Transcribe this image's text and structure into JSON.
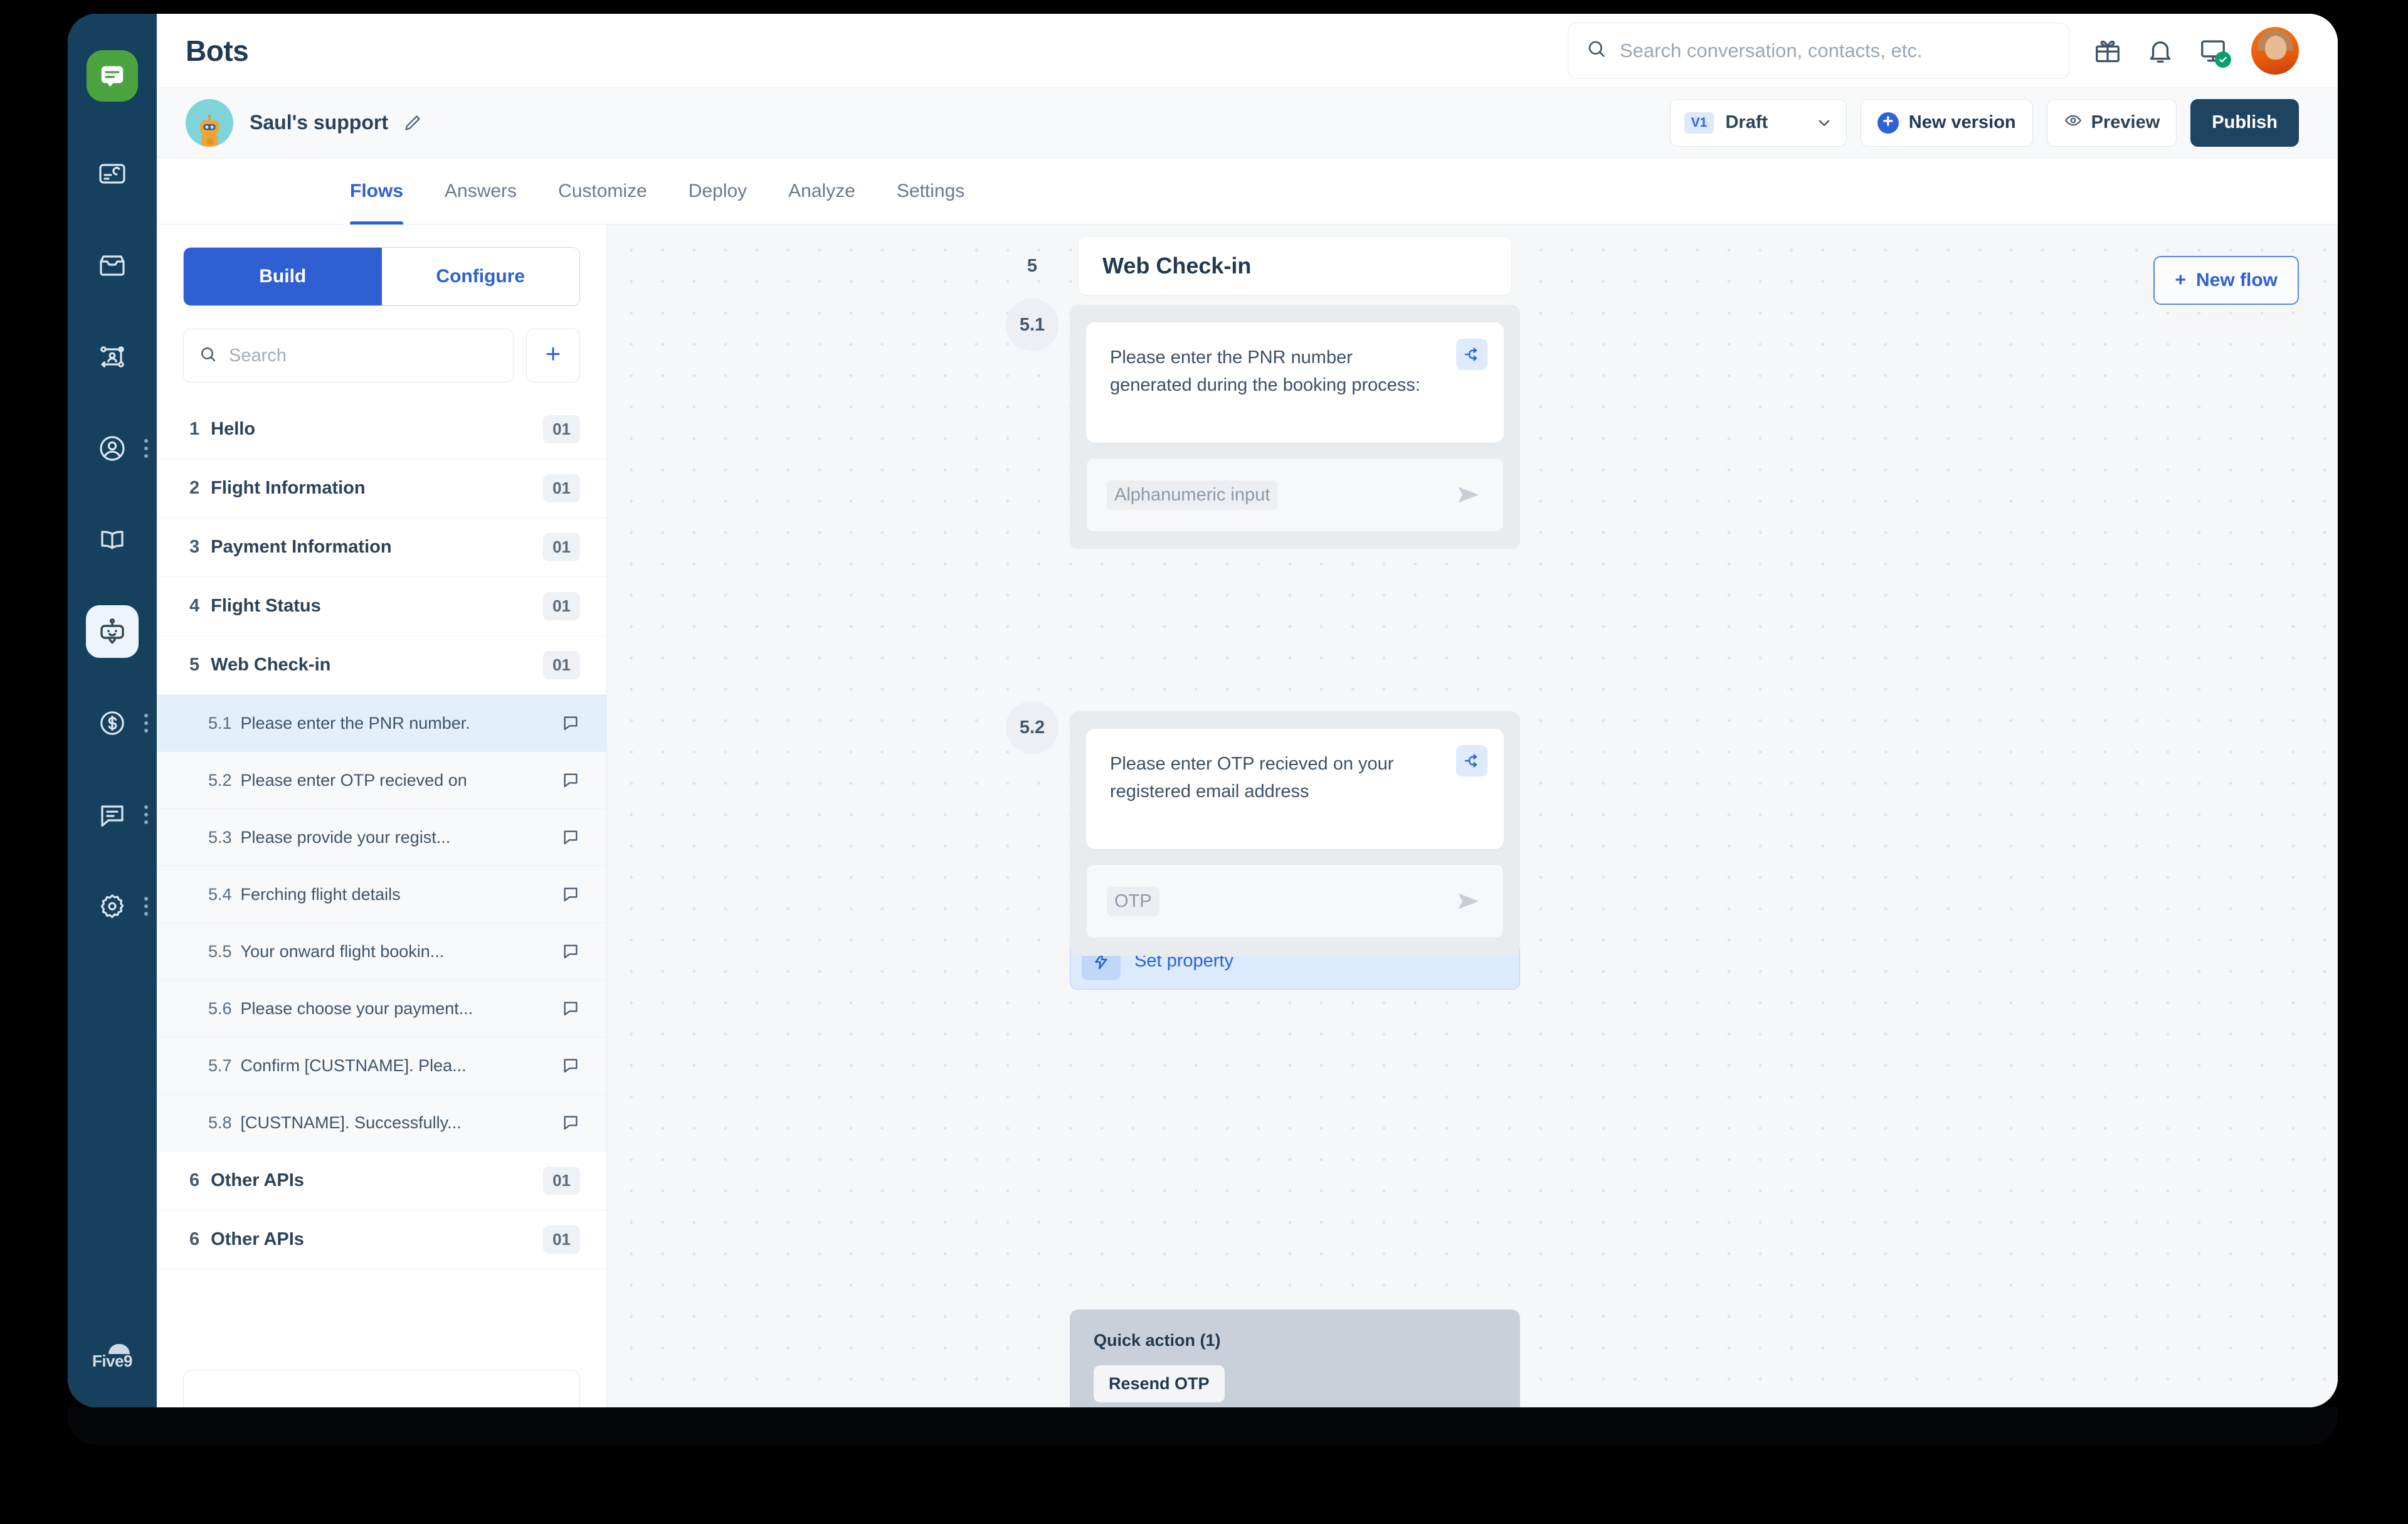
{
  "colors": {
    "rail_bg": "#15405e",
    "brand_green": "#4aa33f",
    "accent_blue": "#2d62d4",
    "publish_bg": "#1f4461",
    "canvas_bg": "#f5f7f9",
    "selected_row": "#e4effc",
    "group_box": "#e9ecef",
    "quick_action_bg": "#c9d0d9",
    "status_green": "#0aa06e",
    "avatar_orange": "#f97316"
  },
  "rail": {
    "logo_icon": "chat-logo-icon",
    "items": [
      {
        "icon": "dashboard-card-icon",
        "name": "sidebar-item-dashboard",
        "has_dots": false,
        "active": false
      },
      {
        "icon": "inbox-icon",
        "name": "sidebar-item-inbox",
        "has_dots": false,
        "active": false
      },
      {
        "icon": "journey-flow-icon",
        "name": "sidebar-item-journeys",
        "has_dots": false,
        "active": false
      },
      {
        "icon": "user-circle-icon",
        "name": "sidebar-item-contacts",
        "has_dots": true,
        "active": false
      },
      {
        "icon": "book-icon",
        "name": "sidebar-item-knowledge",
        "has_dots": false,
        "active": false
      },
      {
        "icon": "bot-icon",
        "name": "sidebar-item-bots",
        "has_dots": false,
        "active": true
      },
      {
        "icon": "dollar-circle-icon",
        "name": "sidebar-item-billing",
        "has_dots": true,
        "active": false
      },
      {
        "icon": "chat-bubble-icon",
        "name": "sidebar-item-conversations",
        "has_dots": true,
        "active": false
      },
      {
        "icon": "gear-icon",
        "name": "sidebar-item-settings",
        "has_dots": true,
        "active": false
      }
    ],
    "footer_logo": "Five9"
  },
  "header": {
    "title": "Bots",
    "search": {
      "placeholder": "Search conversation, contacts, etc.",
      "value": "",
      "icon": "search-icon"
    },
    "icons": [
      {
        "name": "gift-icon",
        "label": "gift-icon"
      },
      {
        "name": "bell-icon",
        "label": "bell-icon"
      },
      {
        "name": "screen-check-icon",
        "label": "screen-check-icon"
      }
    ],
    "avatar": "user-avatar"
  },
  "bot_bar": {
    "avatar_icon": "robot-avatar-icon",
    "bot_name": "Saul's support",
    "edit_icon": "pencil-icon",
    "version_badge": "V1",
    "version_label": "Draft",
    "new_version_label": "New version",
    "preview_label": "Preview",
    "publish_label": "Publish"
  },
  "tabs": [
    {
      "label": "Flows",
      "active": true
    },
    {
      "label": "Answers",
      "active": false
    },
    {
      "label": "Customize",
      "active": false
    },
    {
      "label": "Deploy",
      "active": false
    },
    {
      "label": "Analyze",
      "active": false
    },
    {
      "label": "Settings",
      "active": false
    }
  ],
  "flow_panel": {
    "segmented": [
      {
        "label": "Build",
        "active": true
      },
      {
        "label": "Configure",
        "active": false
      }
    ],
    "search": {
      "placeholder": "Search",
      "value": "",
      "icon": "search-icon"
    },
    "add_button": "+",
    "rows": [
      {
        "type": "flow",
        "index": "1",
        "name": "Hello",
        "count": "01",
        "selected": false
      },
      {
        "type": "flow",
        "index": "2",
        "name": "Flight Information",
        "count": "01",
        "selected": false
      },
      {
        "type": "flow",
        "index": "3",
        "name": "Payment Information",
        "count": "01",
        "selected": false
      },
      {
        "type": "flow",
        "index": "4",
        "name": "Flight Status",
        "count": "01",
        "selected": false
      },
      {
        "type": "flow",
        "index": "5",
        "name": "Web Check-in",
        "count": "01",
        "selected": false
      },
      {
        "type": "sub",
        "index": "5.1",
        "name": "Please enter the PNR number.",
        "selected": true,
        "icon": "message-bubble-icon"
      },
      {
        "type": "sub",
        "index": "5.2",
        "name": "Please enter OTP recieved on",
        "selected": false,
        "icon": "message-bubble-icon"
      },
      {
        "type": "sub",
        "index": "5.3",
        "name": "Please provide your regist...",
        "selected": false,
        "icon": "message-bubble-icon"
      },
      {
        "type": "sub",
        "index": "5.4",
        "name": "Ferching flight details",
        "selected": false,
        "icon": "message-bubble-icon"
      },
      {
        "type": "sub",
        "index": "5.5",
        "name": "Your onward flight bookin...",
        "selected": false,
        "icon": "message-bubble-icon"
      },
      {
        "type": "sub",
        "index": "5.6",
        "name": "Please choose your payment...",
        "selected": false,
        "icon": "message-bubble-icon"
      },
      {
        "type": "sub",
        "index": "5.7",
        "name": "Confirm [CUSTNAME]. Plea...",
        "selected": false,
        "icon": "message-bubble-icon"
      },
      {
        "type": "sub",
        "index": "5.8",
        "name": "[CUSTNAME]. Successfully...",
        "selected": false,
        "icon": "message-bubble-icon"
      },
      {
        "type": "flow",
        "index": "6",
        "name": "Other APIs",
        "count": "01",
        "selected": false
      },
      {
        "type": "flow",
        "index": "6",
        "name": "Other APIs",
        "count": "01",
        "selected": false
      }
    ]
  },
  "canvas": {
    "new_flow_label": "New flow",
    "flow_badge": "5",
    "flow_title": "Web Check-in",
    "nodes": [
      {
        "badge": "5.1",
        "message": "Please enter the PNR number generated during the booking process:",
        "branch_icon": "branch-icon",
        "input_placeholder": "Alphanumeric input",
        "send_icon": "send-icon"
      },
      {
        "badge": "5.2",
        "message": "Please enter OTP recieved on your registered email address",
        "branch_icon": "branch-icon",
        "input_placeholder": "OTP",
        "send_icon": "send-icon"
      }
    ],
    "set_property": {
      "label": "Set property",
      "icon": "lightning-icon"
    },
    "quick_action": {
      "title": "Quick action (1)",
      "chips": [
        "Resend OTP"
      ]
    }
  }
}
